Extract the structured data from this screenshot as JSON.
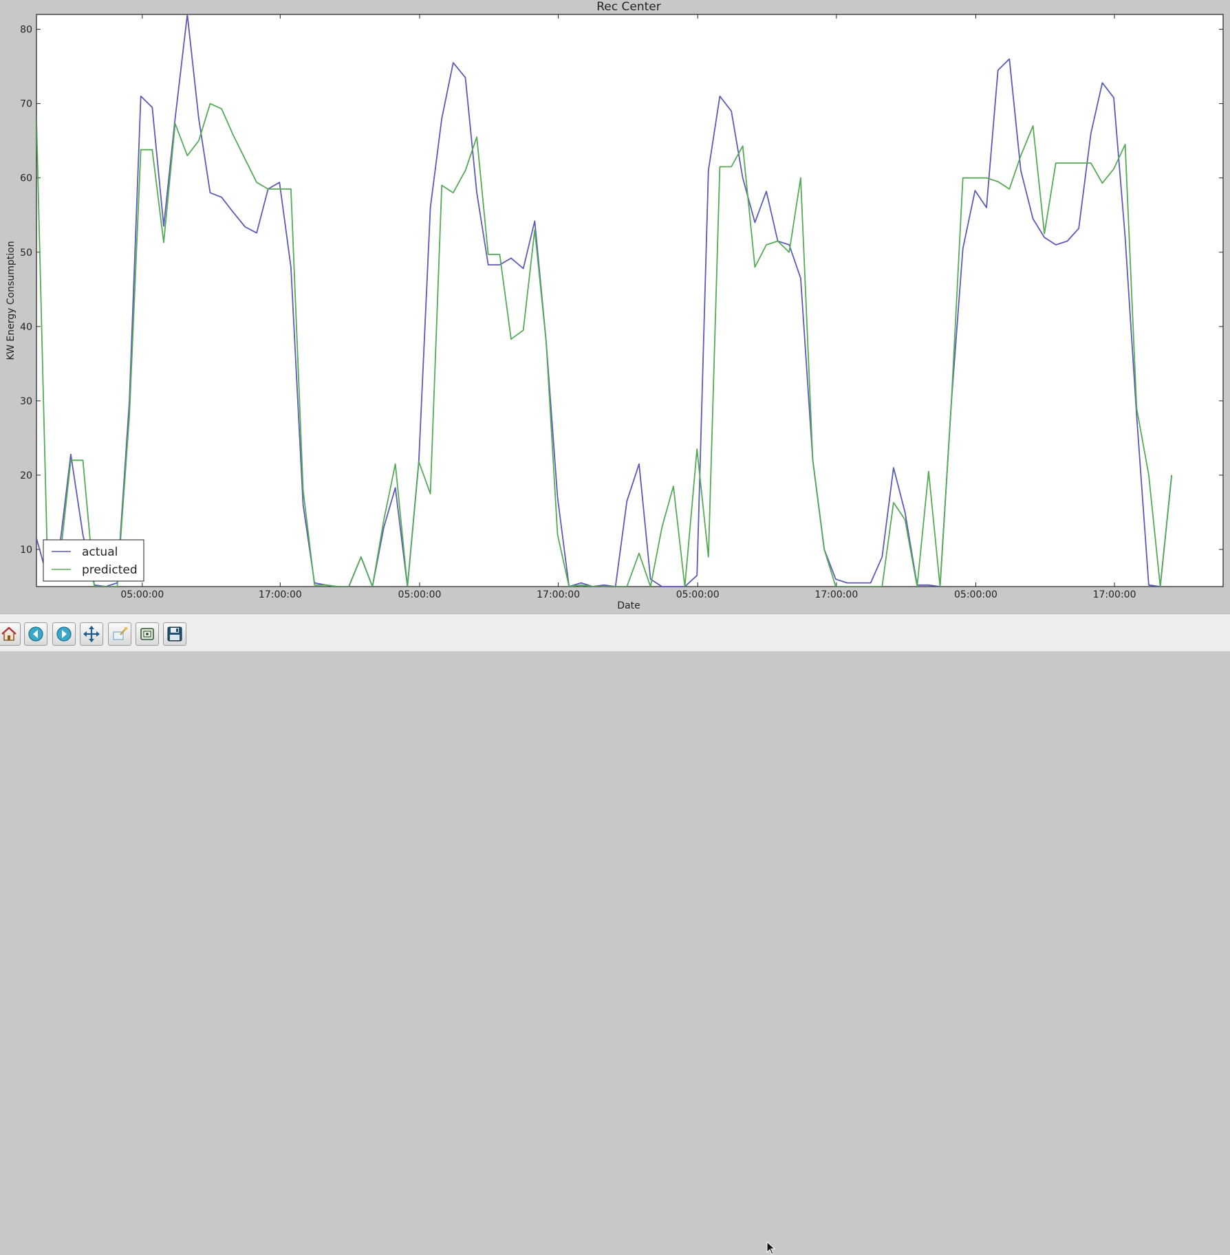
{
  "toolbar": {
    "buttons": [
      {
        "name": "home-button",
        "icon": "home-icon"
      },
      {
        "name": "back-button",
        "icon": "back-arrow-icon"
      },
      {
        "name": "forward-button",
        "icon": "forward-arrow-icon"
      },
      {
        "name": "pan-button",
        "icon": "move-icon"
      },
      {
        "name": "zoom-button",
        "icon": "zoom-rect-icon"
      },
      {
        "name": "configure-subplots-button",
        "icon": "subplots-icon"
      },
      {
        "name": "save-button",
        "icon": "floppy-disk-icon"
      }
    ]
  },
  "chart_data": {
    "type": "line",
    "title": "Rec Center",
    "xlabel": "Date",
    "ylabel": "KW Energy Consumption",
    "xlim": [
      0,
      166
    ],
    "ylim": [
      5,
      82
    ],
    "yticks": [
      10,
      20,
      30,
      40,
      50,
      60,
      70,
      80
    ],
    "xticks": [
      {
        "x": 14.8,
        "label": "05:00:00"
      },
      {
        "x": 34.1,
        "label": "17:00:00"
      },
      {
        "x": 53.6,
        "label": "05:00:00"
      },
      {
        "x": 73.0,
        "label": "17:00:00"
      },
      {
        "x": 92.5,
        "label": "05:00:00"
      },
      {
        "x": 111.9,
        "label": "17:00:00"
      },
      {
        "x": 131.4,
        "label": "05:00:00"
      },
      {
        "x": 150.8,
        "label": "17:00:00"
      }
    ],
    "legend_position": "lower-left",
    "grid": false,
    "series": [
      {
        "name": "actual",
        "color": "#5a5ab8",
        "points": [
          [
            0,
            11.5
          ],
          [
            1.6,
            6
          ],
          [
            3.2,
            10
          ],
          [
            4.8,
            22.8
          ],
          [
            6.5,
            12
          ],
          [
            8.1,
            5.2
          ],
          [
            9.7,
            5
          ],
          [
            11.3,
            5.5
          ],
          [
            13,
            30
          ],
          [
            14.6,
            71
          ],
          [
            16.2,
            69.5
          ],
          [
            17.8,
            53.5
          ],
          [
            19.4,
            68
          ],
          [
            21.1,
            82
          ],
          [
            22.7,
            68
          ],
          [
            24.3,
            58
          ],
          [
            25.9,
            57.4
          ],
          [
            27.5,
            55.4
          ],
          [
            29.2,
            53.4
          ],
          [
            30.8,
            52.6
          ],
          [
            32.4,
            58.5
          ],
          [
            34,
            59.4
          ],
          [
            35.6,
            48
          ],
          [
            37.3,
            16
          ],
          [
            38.9,
            5.5
          ],
          [
            40.5,
            5.2
          ],
          [
            42.1,
            5
          ],
          [
            43.7,
            5
          ],
          [
            45.4,
            9
          ],
          [
            47,
            5
          ],
          [
            48.6,
            13
          ],
          [
            50.2,
            18.3
          ],
          [
            51.9,
            5
          ],
          [
            53.5,
            22
          ],
          [
            55.1,
            56
          ],
          [
            56.7,
            68
          ],
          [
            58.3,
            75.5
          ],
          [
            60,
            73.5
          ],
          [
            61.6,
            58
          ],
          [
            63.2,
            48.3
          ],
          [
            64.8,
            48.3
          ],
          [
            66.4,
            49.2
          ],
          [
            68.1,
            47.8
          ],
          [
            69.7,
            54.2
          ],
          [
            71.3,
            38
          ],
          [
            72.9,
            17
          ],
          [
            74.5,
            5
          ],
          [
            76.2,
            5.5
          ],
          [
            77.8,
            5
          ],
          [
            79.4,
            5.2
          ],
          [
            81,
            5
          ],
          [
            82.6,
            16.5
          ],
          [
            84.3,
            21.5
          ],
          [
            85.9,
            6
          ],
          [
            87.5,
            5
          ],
          [
            89.1,
            5
          ],
          [
            90.7,
            5
          ],
          [
            92.4,
            6.5
          ],
          [
            94,
            61
          ],
          [
            95.6,
            71
          ],
          [
            97.2,
            69
          ],
          [
            98.8,
            60
          ],
          [
            100.5,
            54
          ],
          [
            102.1,
            58.2
          ],
          [
            103.7,
            51.5
          ],
          [
            105.3,
            51
          ],
          [
            106.9,
            46.5
          ],
          [
            108.6,
            22
          ],
          [
            110.2,
            10
          ],
          [
            111.8,
            6
          ],
          [
            113.4,
            5.5
          ],
          [
            115,
            5.5
          ],
          [
            116.7,
            5.5
          ],
          [
            118.3,
            9
          ],
          [
            119.9,
            21
          ],
          [
            121.5,
            15
          ],
          [
            123.2,
            5.2
          ],
          [
            124.8,
            5.2
          ],
          [
            126.4,
            5
          ],
          [
            128,
            30
          ],
          [
            129.6,
            50.5
          ],
          [
            131.3,
            58.3
          ],
          [
            132.9,
            56
          ],
          [
            134.5,
            74.5
          ],
          [
            136.1,
            76
          ],
          [
            137.7,
            61
          ],
          [
            139.4,
            54.5
          ],
          [
            141,
            52
          ],
          [
            142.6,
            51
          ],
          [
            144.2,
            51.5
          ],
          [
            145.8,
            53.2
          ],
          [
            147.5,
            66
          ],
          [
            149.1,
            72.8
          ],
          [
            150.7,
            70.8
          ],
          [
            152.3,
            52
          ],
          [
            153.9,
            28
          ],
          [
            155.6,
            5.2
          ],
          [
            157.2,
            5
          ],
          [
            158.8,
            20
          ]
        ]
      },
      {
        "name": "predicted",
        "color": "#55aa55",
        "points": [
          [
            0,
            68
          ],
          [
            1.6,
            6
          ],
          [
            3.2,
            8
          ],
          [
            4.8,
            22
          ],
          [
            6.5,
            22
          ],
          [
            8.1,
            5
          ],
          [
            9.7,
            5
          ],
          [
            11.3,
            5
          ],
          [
            13,
            28
          ],
          [
            14.6,
            63.8
          ],
          [
            16.2,
            63.8
          ],
          [
            17.8,
            51.3
          ],
          [
            19.4,
            67.3
          ],
          [
            21.1,
            63
          ],
          [
            22.7,
            65
          ],
          [
            24.3,
            70
          ],
          [
            25.9,
            69.3
          ],
          [
            27.5,
            65.8
          ],
          [
            29.2,
            62.5
          ],
          [
            30.8,
            59.4
          ],
          [
            32.4,
            58.5
          ],
          [
            34,
            58.5
          ],
          [
            35.6,
            58.5
          ],
          [
            37.3,
            18
          ],
          [
            38.9,
            5.2
          ],
          [
            40.5,
            5.2
          ],
          [
            42.1,
            5
          ],
          [
            43.7,
            5
          ],
          [
            45.4,
            9
          ],
          [
            47,
            5
          ],
          [
            48.6,
            14
          ],
          [
            50.2,
            21.5
          ],
          [
            51.9,
            5
          ],
          [
            53.5,
            21.8
          ],
          [
            55.1,
            17.5
          ],
          [
            56.7,
            59
          ],
          [
            58.3,
            58
          ],
          [
            60,
            61
          ],
          [
            61.6,
            65.5
          ],
          [
            63.2,
            49.7
          ],
          [
            64.8,
            49.7
          ],
          [
            66.4,
            38.3
          ],
          [
            68.1,
            39.5
          ],
          [
            69.7,
            53
          ],
          [
            71.3,
            38
          ],
          [
            72.9,
            12
          ],
          [
            74.5,
            5
          ],
          [
            76.2,
            5.2
          ],
          [
            77.8,
            5
          ],
          [
            79.4,
            5
          ],
          [
            81,
            5
          ],
          [
            82.6,
            5
          ],
          [
            84.3,
            9.5
          ],
          [
            85.9,
            5
          ],
          [
            87.5,
            13
          ],
          [
            89.1,
            18.5
          ],
          [
            90.7,
            5
          ],
          [
            92.4,
            23.5
          ],
          [
            94,
            9
          ],
          [
            95.6,
            61.5
          ],
          [
            97.2,
            61.5
          ],
          [
            98.8,
            64.3
          ],
          [
            100.5,
            48
          ],
          [
            102.1,
            51
          ],
          [
            103.7,
            51.5
          ],
          [
            105.3,
            50
          ],
          [
            106.9,
            60
          ],
          [
            108.6,
            22
          ],
          [
            110.2,
            10
          ],
          [
            111.8,
            5
          ],
          [
            113.4,
            5
          ],
          [
            115,
            5
          ],
          [
            116.7,
            5
          ],
          [
            118.3,
            5
          ],
          [
            119.9,
            16.3
          ],
          [
            121.5,
            14
          ],
          [
            123.2,
            5
          ],
          [
            124.8,
            20.5
          ],
          [
            126.4,
            5
          ],
          [
            128,
            30
          ],
          [
            129.6,
            60
          ],
          [
            131.3,
            60
          ],
          [
            132.9,
            60
          ],
          [
            134.5,
            59.5
          ],
          [
            136.1,
            58.5
          ],
          [
            137.7,
            63
          ],
          [
            139.4,
            67
          ],
          [
            141,
            52.5
          ],
          [
            142.6,
            62
          ],
          [
            144.2,
            62
          ],
          [
            145.8,
            62
          ],
          [
            147.5,
            62
          ],
          [
            149.1,
            59.3
          ],
          [
            150.7,
            61.2
          ],
          [
            152.3,
            64.5
          ],
          [
            153.9,
            29
          ],
          [
            155.6,
            20
          ],
          [
            157.2,
            5
          ],
          [
            158.8,
            20
          ]
        ]
      }
    ]
  }
}
